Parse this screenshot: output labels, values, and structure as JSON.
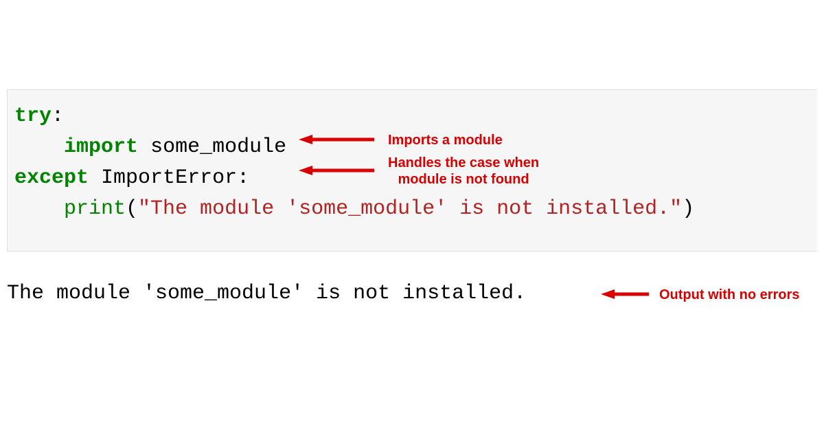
{
  "code": {
    "line1_kw": "try",
    "line1_colon": ":",
    "line2_indent": "    ",
    "line2_kw": "import",
    "line2_sp": " ",
    "line2_mod": "some_module",
    "line3_kw": "except",
    "line3_sp": " ",
    "line3_err": "ImportError",
    "line3_colon": ":",
    "line4_indent": "    ",
    "line4_fn": "print",
    "line4_open": "(",
    "line4_str": "\"The module 'some_module' is not installed.\"",
    "line4_close": ")"
  },
  "output": {
    "text": "The module 'some_module' is not installed."
  },
  "annotations": {
    "a1": "Imports a module",
    "a2": "Handles the case when\nmodule is not found",
    "a3": "Output with no errors"
  }
}
